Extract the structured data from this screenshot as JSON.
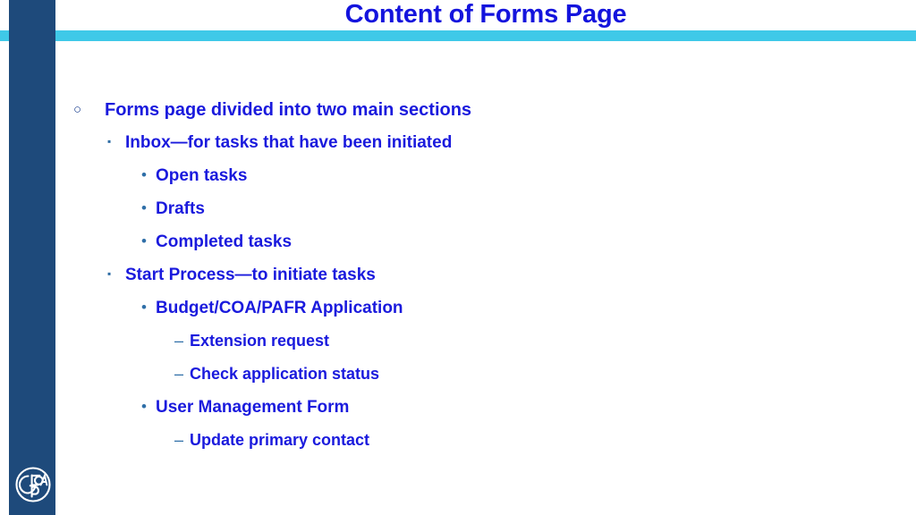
{
  "slide": {
    "title": "Content of Forms Page",
    "colors": {
      "sidebar": "#1e4a7b",
      "accent_bar": "#3fc9e8",
      "title_text": "#1414dd",
      "body_text": "#1a1add",
      "background": "#ffffff"
    },
    "bullets": [
      {
        "level": 1,
        "marker": "○",
        "text": "Forms page divided into two main sections"
      },
      {
        "level": 2,
        "marker": "▪",
        "text": "Inbox—for tasks that have been initiated"
      },
      {
        "level": 3,
        "marker": "•",
        "text": "Open tasks"
      },
      {
        "level": 3,
        "marker": "•",
        "text": "Drafts"
      },
      {
        "level": 3,
        "marker": "•",
        "text": "Completed tasks"
      },
      {
        "level": 2,
        "marker": "▪",
        "text": "Start Process—to initiate tasks"
      },
      {
        "level": 3,
        "marker": "•",
        "text": "Budget/COA/PAFR Application"
      },
      {
        "level": 4,
        "marker": "–",
        "text": "Extension request"
      },
      {
        "level": 4,
        "marker": "–",
        "text": "Check application status"
      },
      {
        "level": 3,
        "marker": "•",
        "text": "User Management Form"
      },
      {
        "level": 4,
        "marker": "–",
        "text": "Update primary contact"
      }
    ],
    "logo": {
      "name": "GFOA",
      "letters": "GFOA"
    }
  }
}
